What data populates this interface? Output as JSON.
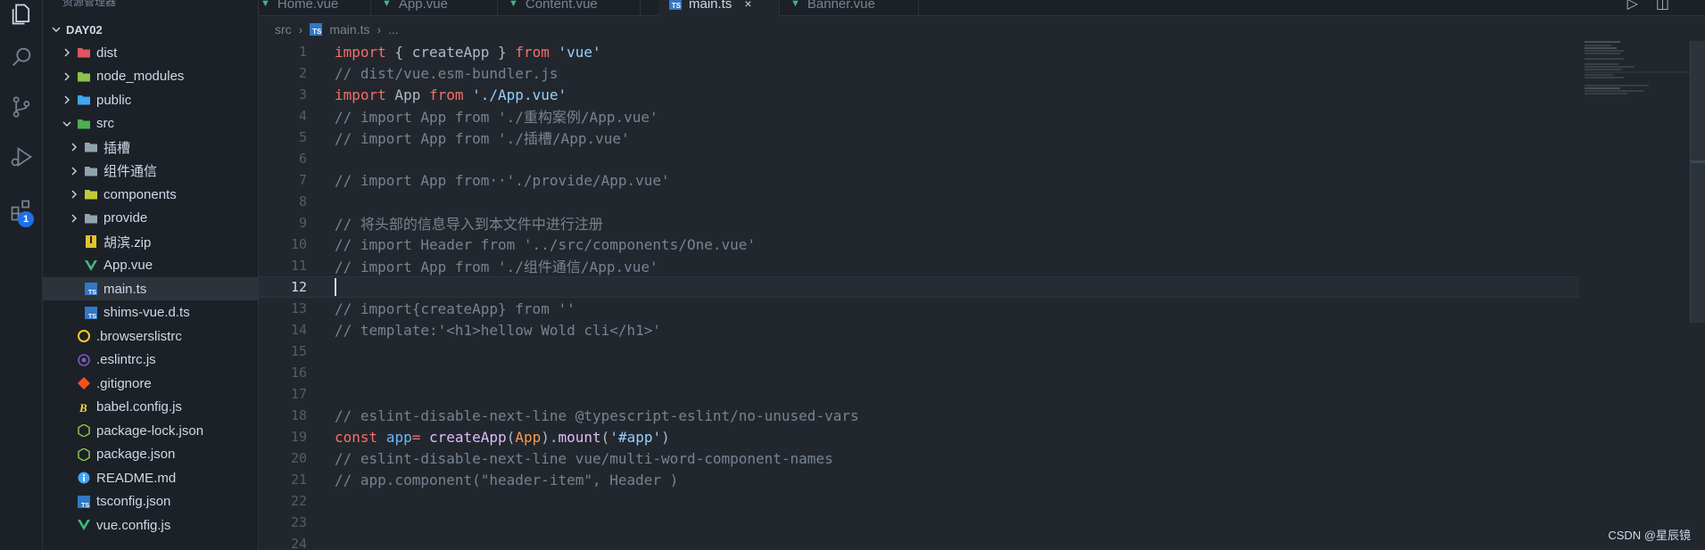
{
  "sidebar": {
    "header": "资源管理器",
    "root": "DAY02",
    "items": [
      {
        "label": "dist",
        "icon": "folder-dist-icon",
        "color": "#e05561"
      },
      {
        "label": "node_modules",
        "icon": "folder-node-icon",
        "color": "#8bc34a"
      },
      {
        "label": "public",
        "icon": "folder-public-icon",
        "color": "#42a5f5"
      },
      {
        "label": "src",
        "icon": "folder-src-icon",
        "color": "#4caf50"
      },
      {
        "label": "插槽",
        "icon": "folder-icon",
        "color": "#90a4ae"
      },
      {
        "label": "组件通信",
        "icon": "folder-icon",
        "color": "#90a4ae"
      },
      {
        "label": "components",
        "icon": "folder-components-icon",
        "color": "#c0ca33"
      },
      {
        "label": "provide",
        "icon": "folder-icon",
        "color": "#90a4ae"
      },
      {
        "label": "胡滨.zip",
        "icon": "zip-icon",
        "color": "#e6c229"
      },
      {
        "label": "App.vue",
        "icon": "vue-icon",
        "color": "#41b883"
      },
      {
        "label": "main.ts",
        "icon": "typescript-icon",
        "color": "#3178c6"
      },
      {
        "label": "shims-vue.d.ts",
        "icon": "typescript-def-icon",
        "color": "#3178c6"
      },
      {
        "label": ".browserslistrc",
        "icon": "browserslist-icon",
        "color": "#ffca28"
      },
      {
        "label": ".eslintrc.js",
        "icon": "eslint-icon",
        "color": "#7e57c2"
      },
      {
        "label": ".gitignore",
        "icon": "git-icon",
        "color": "#f4511e"
      },
      {
        "label": "babel.config.js",
        "icon": "babel-icon",
        "color": "#fdd835"
      },
      {
        "label": "package-lock.json",
        "icon": "nodejs-icon",
        "color": "#8bc34a"
      },
      {
        "label": "package.json",
        "icon": "nodejs-icon",
        "color": "#8bc34a"
      },
      {
        "label": "README.md",
        "icon": "info-icon",
        "color": "#42a5f5"
      },
      {
        "label": "tsconfig.json",
        "icon": "tsconfig-icon",
        "color": "#3178c6"
      },
      {
        "label": "vue.config.js",
        "icon": "vue-config-icon",
        "color": "#41b883"
      }
    ]
  },
  "tabs": [
    {
      "label": "Home.vue",
      "icon": "vue-icon"
    },
    {
      "label": "App.vue",
      "icon": "vue-icon"
    },
    {
      "label": "Content.vue",
      "icon": "vue-icon"
    },
    {
      "label": "main.ts",
      "icon": "typescript-icon",
      "active": true,
      "close": "×"
    },
    {
      "label": "Banner.vue",
      "icon": "vue-icon"
    }
  ],
  "breadcrumb": {
    "folder": "src",
    "sep": "›",
    "file": "main.ts",
    "more": "..."
  },
  "editor": {
    "lines": [
      {
        "n": "1"
      },
      {
        "n": "2"
      },
      {
        "n": "3"
      },
      {
        "n": "4"
      },
      {
        "n": "5"
      },
      {
        "n": "6"
      },
      {
        "n": "7"
      },
      {
        "n": "8"
      },
      {
        "n": "9"
      },
      {
        "n": "10"
      },
      {
        "n": "11"
      },
      {
        "n": "12"
      },
      {
        "n": "13"
      },
      {
        "n": "14"
      },
      {
        "n": "15"
      },
      {
        "n": "16"
      },
      {
        "n": "17"
      },
      {
        "n": "18"
      },
      {
        "n": "19"
      },
      {
        "n": "20"
      },
      {
        "n": "21"
      },
      {
        "n": "22"
      },
      {
        "n": "23"
      },
      {
        "n": "24"
      }
    ],
    "code": {
      "l1_a": "import",
      "l1_b": " { ",
      "l1_c": "createApp",
      "l1_d": " } ",
      "l1_e": "from",
      "l1_f": " ",
      "l1_g": "'vue'",
      "l2": "// dist/vue.esm-bundler.js",
      "l3_a": "import",
      "l3_b": " App ",
      "l3_c": "from",
      "l3_d": " ",
      "l3_e": "'./App.vue'",
      "l4": "// import App from './重构案例/App.vue'",
      "l5": "// import App from './插槽/App.vue'",
      "l7": "// import App from··'./provide/App.vue'",
      "l9": "// 将头部的信息导入到本文件中进行注册",
      "l10": "// import Header from '../src/components/One.vue'",
      "l11": "// import App from './组件通信/App.vue'",
      "l13": "// import{createApp} from ''",
      "l14": "// template:'<h1>hellow Wold cli</h1>'",
      "l18": "// eslint-disable-next-line @typescript-eslint/no-unused-vars",
      "l19_a": "const",
      "l19_b": " ",
      "l19_c": "app",
      "l19_d": "= ",
      "l19_e": "createApp",
      "l19_f": "(",
      "l19_g": "App",
      "l19_h": ").",
      "l19_i": "mount",
      "l19_j": "(",
      "l19_k": "'#app'",
      "l19_l": ")",
      "l20": "// eslint-disable-next-line vue/multi-word-component-names",
      "l21": "// app.component(\"header-item\", Header )"
    },
    "current_line": "12"
  },
  "activity": {
    "items": [
      "explorer-icon",
      "search-icon",
      "source-control-icon",
      "run-debug-icon",
      "extensions-icon"
    ],
    "extensions_badge": "1"
  },
  "watermark": "CSDN @星辰镜"
}
